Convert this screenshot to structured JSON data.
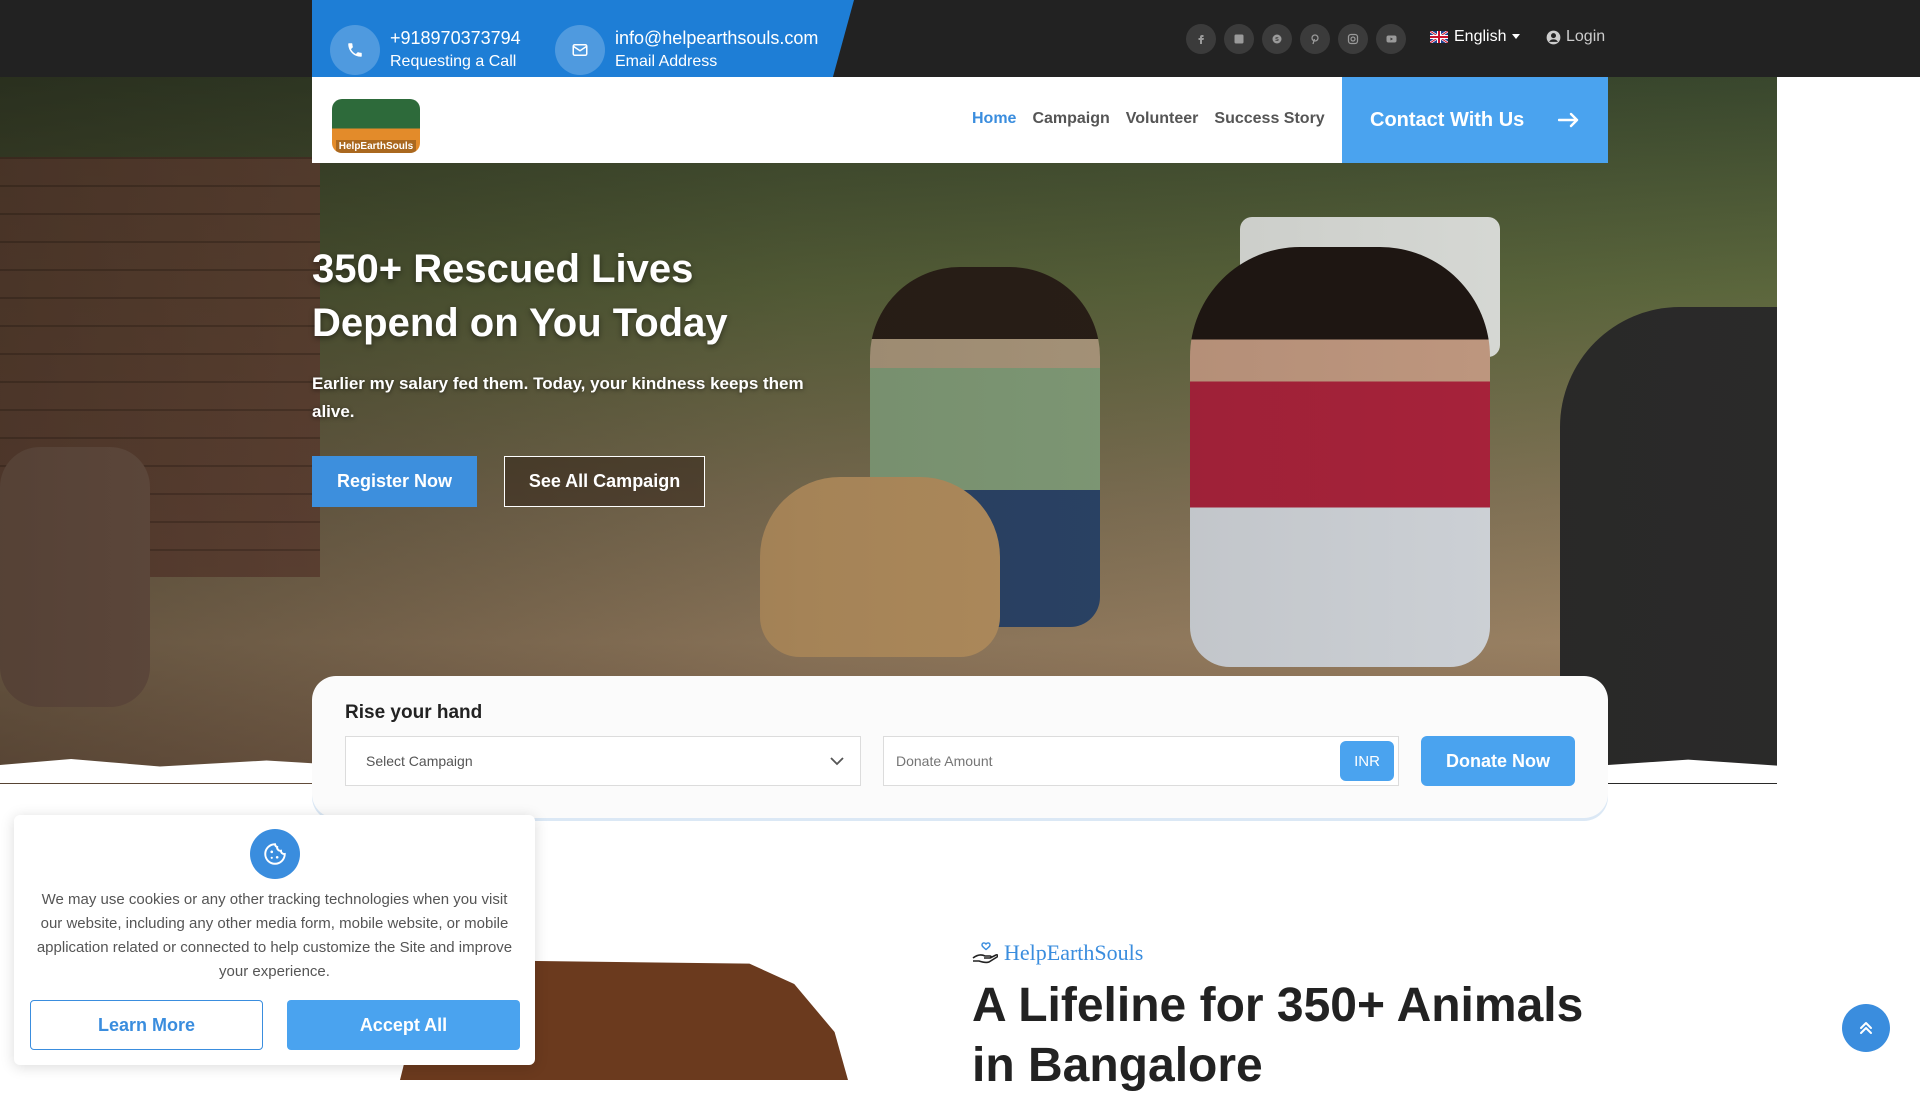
{
  "topbar": {
    "phone": {
      "number": "+918970373794",
      "label": "Requesting a Call",
      "icon": "phone-icon"
    },
    "email": {
      "address": "info@helpearthsouls.com",
      "label": "Email Address",
      "icon": "mail-icon"
    },
    "socials": [
      "facebook-icon",
      "twitter-icon",
      "skype-icon",
      "pinterest-icon",
      "instagram-icon",
      "youtube-icon"
    ],
    "language": "English",
    "login": "Login"
  },
  "nav": {
    "logo_text": "HelpEarthSouls",
    "links": [
      "Home",
      "Campaign",
      "Volunteer",
      "Success Story"
    ],
    "active": "Home",
    "contact_button": "Contact With Us"
  },
  "hero": {
    "title_line1": "350+ Rescued Lives",
    "title_line2": "Depend on You Today",
    "subtitle": "Earlier my salary fed them. Today, your kindness keeps them alive.",
    "register_button": "Register Now",
    "campaign_button": "See All Campaign"
  },
  "donate": {
    "title": "Rise your hand",
    "select_placeholder": "Select Campaign",
    "amount_placeholder": "Donate Amount",
    "currency": "INR",
    "button": "Donate Now"
  },
  "about": {
    "brand": "HelpEarthSouls",
    "title": "A Lifeline for 350+ Animals in Bangalore"
  },
  "cookie": {
    "text": "We may use cookies or any other tracking technologies when you visit our website, including any other media form, mobile website, or mobile application related or connected to help customize the Site and improve your experience.",
    "learn_more": "Learn More",
    "accept": "Accept All"
  },
  "colors": {
    "primary": "#3a8dde",
    "primary_light": "#4aa3ef",
    "topbar": "#222222",
    "contact_box": "#1e7ed6"
  }
}
